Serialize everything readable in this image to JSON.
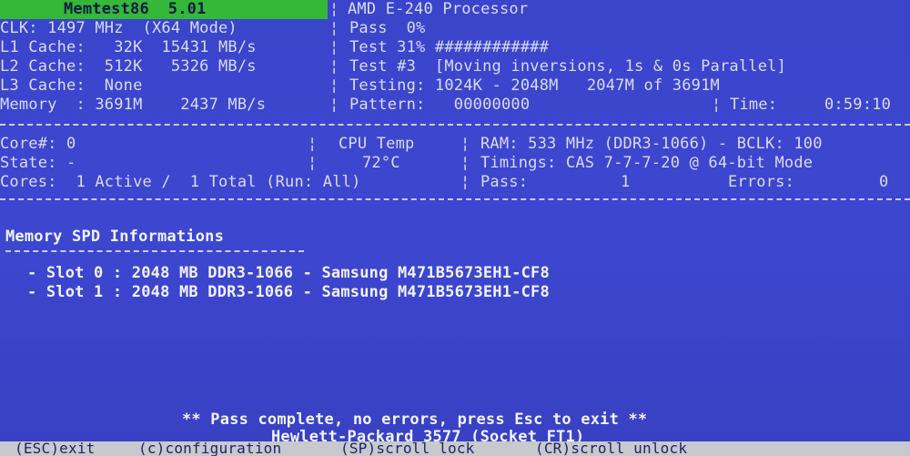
{
  "header": {
    "app_title": "Memtest86  5.01",
    "processor": "AMD E-240 Processor",
    "clk": "CLK: 1497 MHz  (X64 Mode)",
    "pass": "Pass  0%",
    "l1": "L1 Cache:   32K  15431 MB/s",
    "test_progress": "Test 31% ############",
    "l2": "L2 Cache:  512K   5326 MB/s",
    "test_num": "Test #3  [Moving inversions, 1s & 0s Parallel]",
    "l3": "L3 Cache:  None",
    "testing": "Testing: 1024K - 2048M   2047M of 3691M",
    "memory": "Memory  : 3691M    2437 MB/s",
    "pattern": "Pattern:   00000000",
    "time_label": "Time:",
    "time_value": "0:59:10"
  },
  "status": {
    "core": "Core#: 0",
    "cpu_temp_label": "CPU Temp",
    "ram": "RAM: 533 MHz (DDR3-1066) - BCLK: 100",
    "state": "State: -",
    "cpu_temp_value": "72°C",
    "timings": "Timings: CAS 7-7-7-20 @ 64-bit Mode",
    "cores": "Cores:  1 Active /  1 Total (Run: All)",
    "pass_label": "Pass:",
    "pass_value": "1",
    "errors_label": "Errors:",
    "errors_value": "0"
  },
  "spd": {
    "heading": "Memory SPD Informations",
    "slots": [
      "- Slot 0 : 2048 MB DDR3-1066 - Samsung M471B5673EH1-CF8",
      "- Slot 1 : 2048 MB DDR3-1066 - Samsung M471B5673EH1-CF8"
    ]
  },
  "messages": {
    "pass_complete": "** Pass complete, no errors, press Esc to exit **",
    "system": "Hewlett-Packard 3577 (Socket FT1)"
  },
  "footer": {
    "esc": "(ESC)exit",
    "config": "(c)configuration",
    "scroll_lock": "(SP)scroll_lock",
    "scroll_unlock": "(CR)scroll_unlock"
  },
  "colors": {
    "background": "#3b44c9",
    "title_bar": "#34b838",
    "footer_bar": "#c7c9cf"
  }
}
